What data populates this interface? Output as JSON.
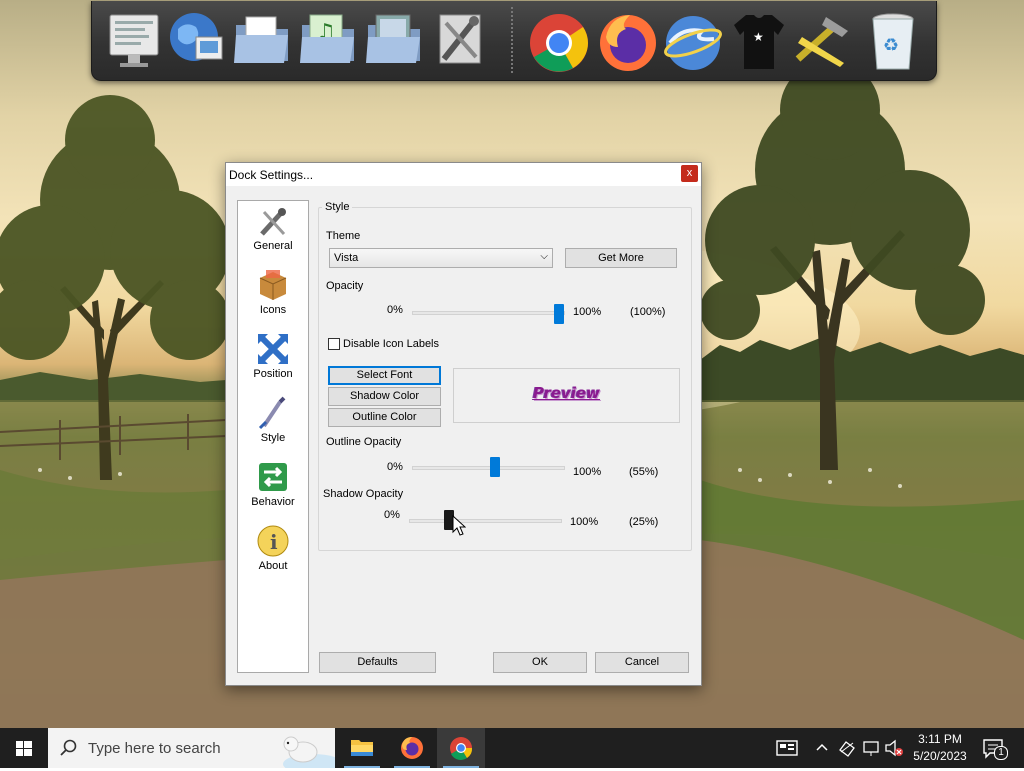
{
  "dock": {
    "icons": [
      "settings-icon",
      "network-icon",
      "folder-documents-icon",
      "folder-music-icon",
      "folder-pictures-icon",
      "tools-icon",
      "chrome-icon",
      "firefox-icon",
      "internet-explorer-icon",
      "tshirt-icon",
      "hammer-icon",
      "recycle-bin-icon"
    ]
  },
  "dialog": {
    "title": "Dock Settings...",
    "close_label": "x",
    "nav": [
      {
        "label": "General"
      },
      {
        "label": "Icons"
      },
      {
        "label": "Position"
      },
      {
        "label": "Style"
      },
      {
        "label": "Behavior"
      },
      {
        "label": "About"
      }
    ],
    "selected_nav": "Style",
    "group_label": "Style",
    "theme": {
      "label": "Theme",
      "value": "Vista",
      "get_more": "Get More"
    },
    "opacity": {
      "label": "Opacity",
      "min": "0%",
      "max": "100%",
      "value_text": "(100%)",
      "value": 100
    },
    "disable_labels": {
      "label": "Disable Icon Labels",
      "checked": false
    },
    "buttons": {
      "select_font": "Select Font",
      "shadow_color": "Shadow Color",
      "outline_color": "Outline Color"
    },
    "preview": "Preview",
    "outline_opacity": {
      "label": "Outline Opacity",
      "min": "0%",
      "max": "100%",
      "value_text": "(55%)",
      "value": 55
    },
    "shadow_opacity": {
      "label": "Shadow Opacity",
      "min": "0%",
      "max": "100%",
      "value_text": "(25%)",
      "value": 25
    },
    "footer": {
      "defaults": "Defaults",
      "ok": "OK",
      "cancel": "Cancel"
    }
  },
  "taskbar": {
    "search_placeholder": "Type here to search",
    "time": "3:11 PM",
    "date": "5/20/2023",
    "notification_count": "1"
  },
  "colors": {
    "accent": "#0078d7",
    "close": "#c42b1c",
    "preview": "#8a1a8f"
  }
}
